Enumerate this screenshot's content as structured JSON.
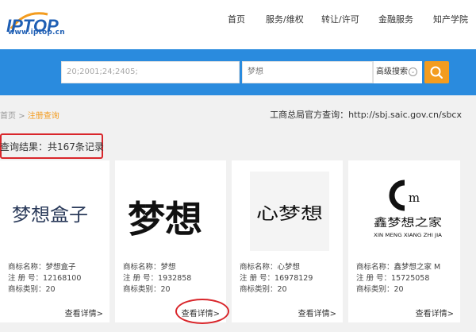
{
  "header": {
    "logo_url": "www.iptop.cn",
    "nav": [
      "首页",
      "服务/维权",
      "转让/许可",
      "金融服务",
      "知产学院"
    ]
  },
  "search": {
    "class_value": "20;2001;24;2405;",
    "keyword_value": "梦想",
    "advanced_label": "高级搜索"
  },
  "breadcrumb": {
    "home": "首页",
    "sep": ">",
    "current": "注册查询"
  },
  "gov_link": "工商总局官方查询：http://sbj.saic.gov.cn/sbcx",
  "result_text": "查询结果：共167条记录",
  "cards": [
    {
      "image_text": "梦想盒子",
      "name_label": "商标名称：",
      "name": "梦想盒子",
      "reg_label": "注 册 号：",
      "reg": "12168100",
      "cat_label": "商标类别：",
      "cat": "20",
      "detail": "查看详情>"
    },
    {
      "image_text": "梦想",
      "name_label": "商标名称：",
      "name": "梦想",
      "reg_label": "注 册 号：",
      "reg": "1932858",
      "cat_label": "商标类别：",
      "cat": "20",
      "detail": "查看详情>"
    },
    {
      "image_text": "心梦想",
      "name_label": "商标名称：",
      "name": "心梦想",
      "reg_label": "注 册 号：",
      "reg": "16978129",
      "cat_label": "商标类别：",
      "cat": "20",
      "detail": "查看详情>"
    },
    {
      "image_text": "鑫梦想之家",
      "image_subtext": "XIN MENG XIANG ZHI JIA",
      "name_label": "商标名称：",
      "name": "鑫梦想之家 M",
      "reg_label": "注 册 号：",
      "reg": "15725058",
      "cat_label": "商标类别：",
      "cat": "20",
      "detail": "查看详情>"
    }
  ],
  "colors": {
    "band": "#2a8bde",
    "search_button": "#f39c1f",
    "highlight": "#d9262b",
    "breadcrumb_active": "#f39c1f"
  }
}
